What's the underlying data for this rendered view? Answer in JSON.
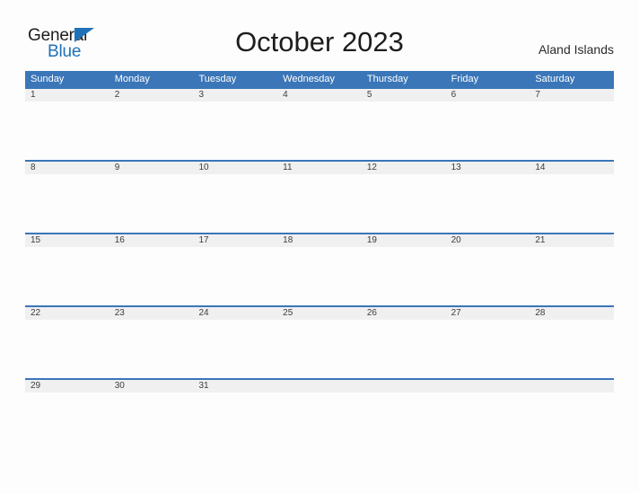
{
  "logo": {
    "word_dark": "General",
    "word_blue": "Blue",
    "flag_icon": "triangle-flag-icon",
    "color_blue": "#2072b8",
    "color_dark": "#1d1d1b"
  },
  "header": {
    "title": "October 2023",
    "location": "Aland Islands"
  },
  "calendar": {
    "month": "October",
    "year": "2023",
    "header_color": "#3a76b8",
    "date_strip_color": "#f0f0f0",
    "weekdays": [
      "Sunday",
      "Monday",
      "Tuesday",
      "Wednesday",
      "Thursday",
      "Friday",
      "Saturday"
    ],
    "weeks": [
      {
        "days": [
          "1",
          "2",
          "3",
          "4",
          "5",
          "6",
          "7"
        ]
      },
      {
        "days": [
          "8",
          "9",
          "10",
          "11",
          "12",
          "13",
          "14"
        ]
      },
      {
        "days": [
          "15",
          "16",
          "17",
          "18",
          "19",
          "20",
          "21"
        ]
      },
      {
        "days": [
          "22",
          "23",
          "24",
          "25",
          "26",
          "27",
          "28"
        ]
      },
      {
        "days": [
          "29",
          "30",
          "31",
          "",
          "",
          "",
          ""
        ]
      }
    ]
  }
}
